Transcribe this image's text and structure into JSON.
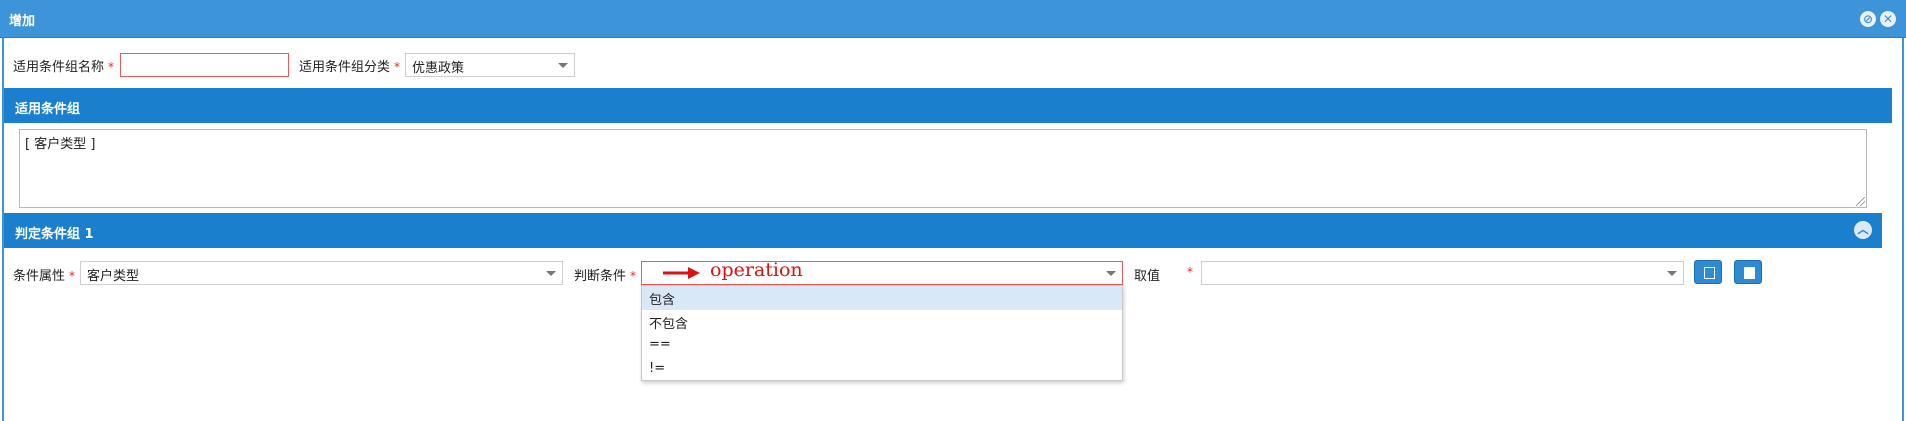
{
  "window": {
    "title": "增加",
    "minimize_icon": "minus-circle-icon",
    "close_icon": "x-circle-icon"
  },
  "header_form": {
    "name_label": "适用条件组名称",
    "name_value": "",
    "category_label": "适用条件组分类",
    "category_value": "优惠政策",
    "required_mark": "*"
  },
  "section_applicable": {
    "title": "适用条件组",
    "textarea_value": "[ 客户类型 ]"
  },
  "section_judge": {
    "title": "判定条件组 1",
    "attr_label": "条件属性",
    "attr_value": "客户类型",
    "condition_label": "判断条件",
    "condition_value": "",
    "annotation": "operation",
    "value_label": "取值",
    "value_value": "",
    "required_mark": "*",
    "options": [
      "包含",
      "不包含",
      "==",
      "!="
    ],
    "selected_index": 0,
    "colors": {
      "section": "#1a7fcc",
      "annotation": "#dd1111",
      "selected_option": "#d9e8f7"
    }
  }
}
